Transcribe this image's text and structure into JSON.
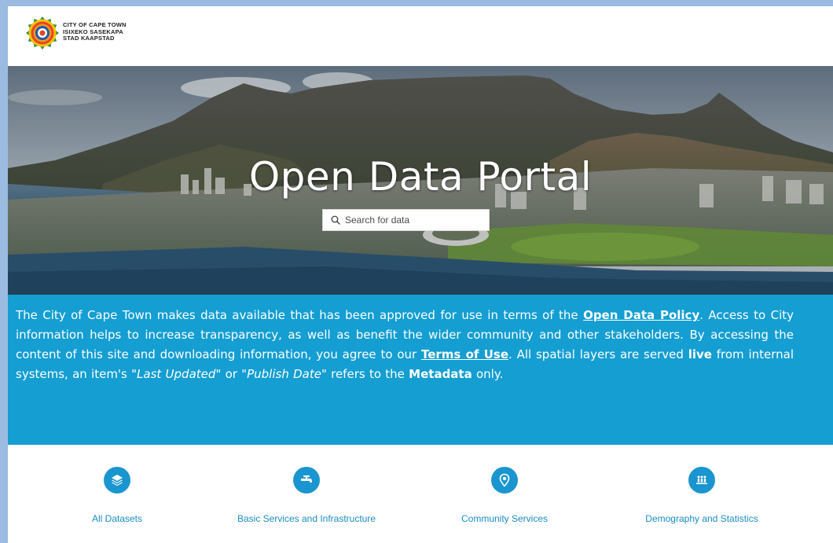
{
  "header": {
    "logo_line1": "CITY OF CAPE TOWN",
    "logo_line2": "ISIXEKO SASEKAPA",
    "logo_line3": "STAD KAAPSTAD",
    "logo_icon": "city-crest-icon"
  },
  "hero": {
    "title": "Open Data Portal",
    "search_placeholder": "Search for data",
    "search_value": "",
    "search_icon": "search-icon"
  },
  "banner": {
    "t1": "The City of Cape Town makes data available that has been approved for use in terms of the ",
    "link_policy": "Open Data Policy",
    "t2": ". Access to City information helps to increase transparency, as well as benefit the wider community and other stakeholders. By accessing the content of this site and downloading information, you agree to our ",
    "link_terms": "Terms of Use",
    "t3": ". All spatial layers are served ",
    "live": "live",
    "t4": " from internal systems, an item's \"",
    "last_updated": "Last Updated",
    "t5": "\" or \"",
    "publish_date": "Publish Date",
    "t6": "\" refers to the ",
    "metadata": "Metadata",
    "t7": " only."
  },
  "categories": [
    {
      "label": "All Datasets",
      "icon": "layers-icon"
    },
    {
      "label": "Basic Services and Infrastructure",
      "icon": "water-tap-icon"
    },
    {
      "label": "Community Services",
      "icon": "location-pin-icon"
    },
    {
      "label": "Demography and Statistics",
      "icon": "people-group-icon"
    }
  ],
  "colors": {
    "banner_bg": "#149ed2",
    "category_icon_bg": "#1a95cf",
    "category_label": "#1a8cc5",
    "page_border": "#9bbbe0"
  }
}
